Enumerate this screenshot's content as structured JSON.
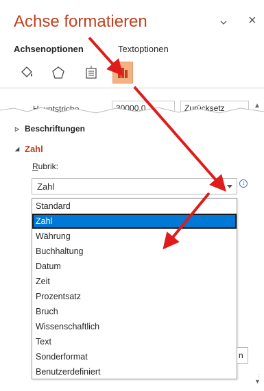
{
  "pane": {
    "title": "Achse formatieren",
    "tabs": [
      {
        "label": "Achsenoptionen",
        "active": true
      },
      {
        "label": "Textoptionen",
        "active": false
      }
    ],
    "icons": [
      {
        "name": "fill-line-icon",
        "selected": false
      },
      {
        "name": "effects-pentagon-icon",
        "selected": false
      },
      {
        "name": "size-properties-icon",
        "selected": false
      },
      {
        "name": "axis-options-chart-icon",
        "selected": true
      }
    ]
  },
  "torn_section": {
    "label": "Hauptstriche",
    "input1": "30000,0",
    "input2": "Zurücksetz"
  },
  "sections": {
    "beschriftungen": "Beschriftungen",
    "zahl": "Zahl"
  },
  "rubrik": {
    "label_underlined": "R",
    "label_rest": "ubrik:",
    "selected": "Zahl"
  },
  "dropdown": {
    "options": [
      "Standard",
      "Zahl",
      "Währung",
      "Buchhaltung",
      "Datum",
      "Zeit",
      "Prozentsatz",
      "Bruch",
      "Wissenschaftlich",
      "Text",
      "Sonderformat",
      "Benutzerdefiniert"
    ],
    "highlighted_index": 1
  },
  "side_box_text": "n",
  "colors": {
    "accent": "#c43e1c",
    "selection": "#0078d7",
    "annotation_arrow": "#e01b1b",
    "icon_selected_bg": "#f4b183"
  }
}
